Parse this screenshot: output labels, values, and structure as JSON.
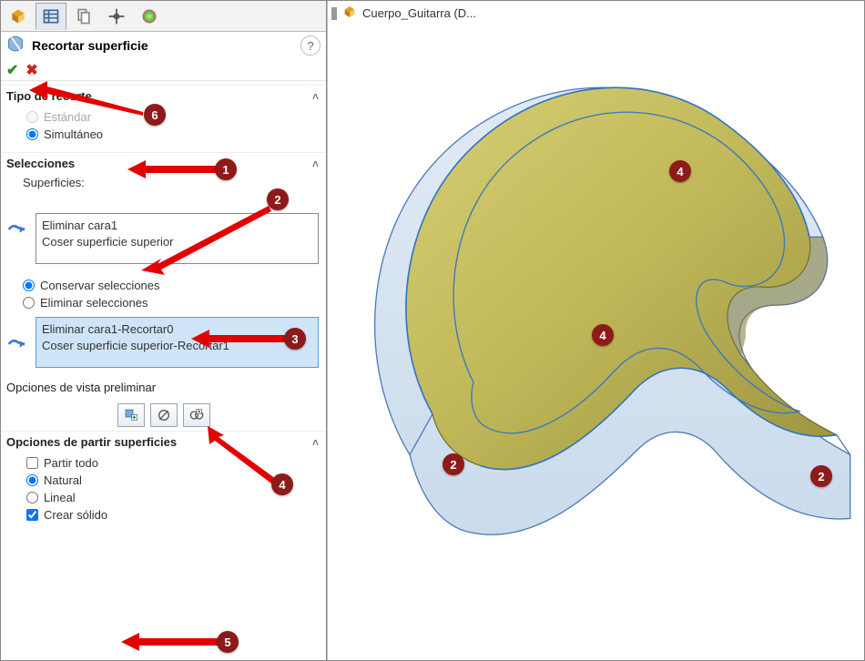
{
  "tabs": {
    "feature_mgr": "feature-manager",
    "property_mgr": "property-manager",
    "config_mgr": "config-manager",
    "dim_mgr": "dim-manager",
    "appearances": "appearances"
  },
  "feature": {
    "title": "Recortar superficie"
  },
  "sections": {
    "trim_type": {
      "title": "Tipo de recorte",
      "standard": "Estándar",
      "simultaneous": "Simultáneo"
    },
    "selections": {
      "title": "Selecciones",
      "surfaces_label": "Superficies:",
      "surfaces_list": [
        "Eliminar cara1",
        "Coser superficie superior"
      ],
      "keep": "Conservar selecciones",
      "remove": "Eliminar selecciones",
      "result_list": [
        "Eliminar cara1-Recortar0",
        "Coser superficie superior-Recortar1"
      ]
    },
    "preview": {
      "title": "Opciones de vista preliminar"
    },
    "split": {
      "title": "Opciones de partir superficies",
      "split_all": "Partir todo",
      "natural": "Natural",
      "linear": "Lineal",
      "create_solid": "Crear sólido"
    }
  },
  "breadcrumb": {
    "part_name": "Cuerpo_Guitarra  (D..."
  },
  "annotations": {
    "a1": "1",
    "a2": "2",
    "a3": "3",
    "a4": "4",
    "a5": "5",
    "a6": "6"
  }
}
